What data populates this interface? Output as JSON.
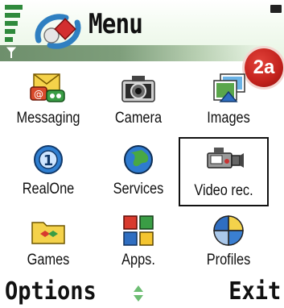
{
  "header": {
    "title": "Menu",
    "badge": "2a"
  },
  "grid": {
    "items": [
      {
        "label": "Messaging",
        "icon": "messaging-icon"
      },
      {
        "label": "Camera",
        "icon": "camera-icon"
      },
      {
        "label": "Images",
        "icon": "images-icon"
      },
      {
        "label": "RealOne",
        "icon": "realone-icon"
      },
      {
        "label": "Services",
        "icon": "globe-icon"
      },
      {
        "label": "Video rec.",
        "icon": "video-camera-icon",
        "selected": true
      },
      {
        "label": "Games",
        "icon": "games-folder-icon"
      },
      {
        "label": "Apps.",
        "icon": "apps-icon"
      },
      {
        "label": "Profiles",
        "icon": "profiles-icon"
      }
    ]
  },
  "softkeys": {
    "left": "Options",
    "right": "Exit"
  },
  "colors": {
    "accent": "#2f8a3c",
    "badge": "#c2211c",
    "header_band": "#7e9e7b"
  }
}
